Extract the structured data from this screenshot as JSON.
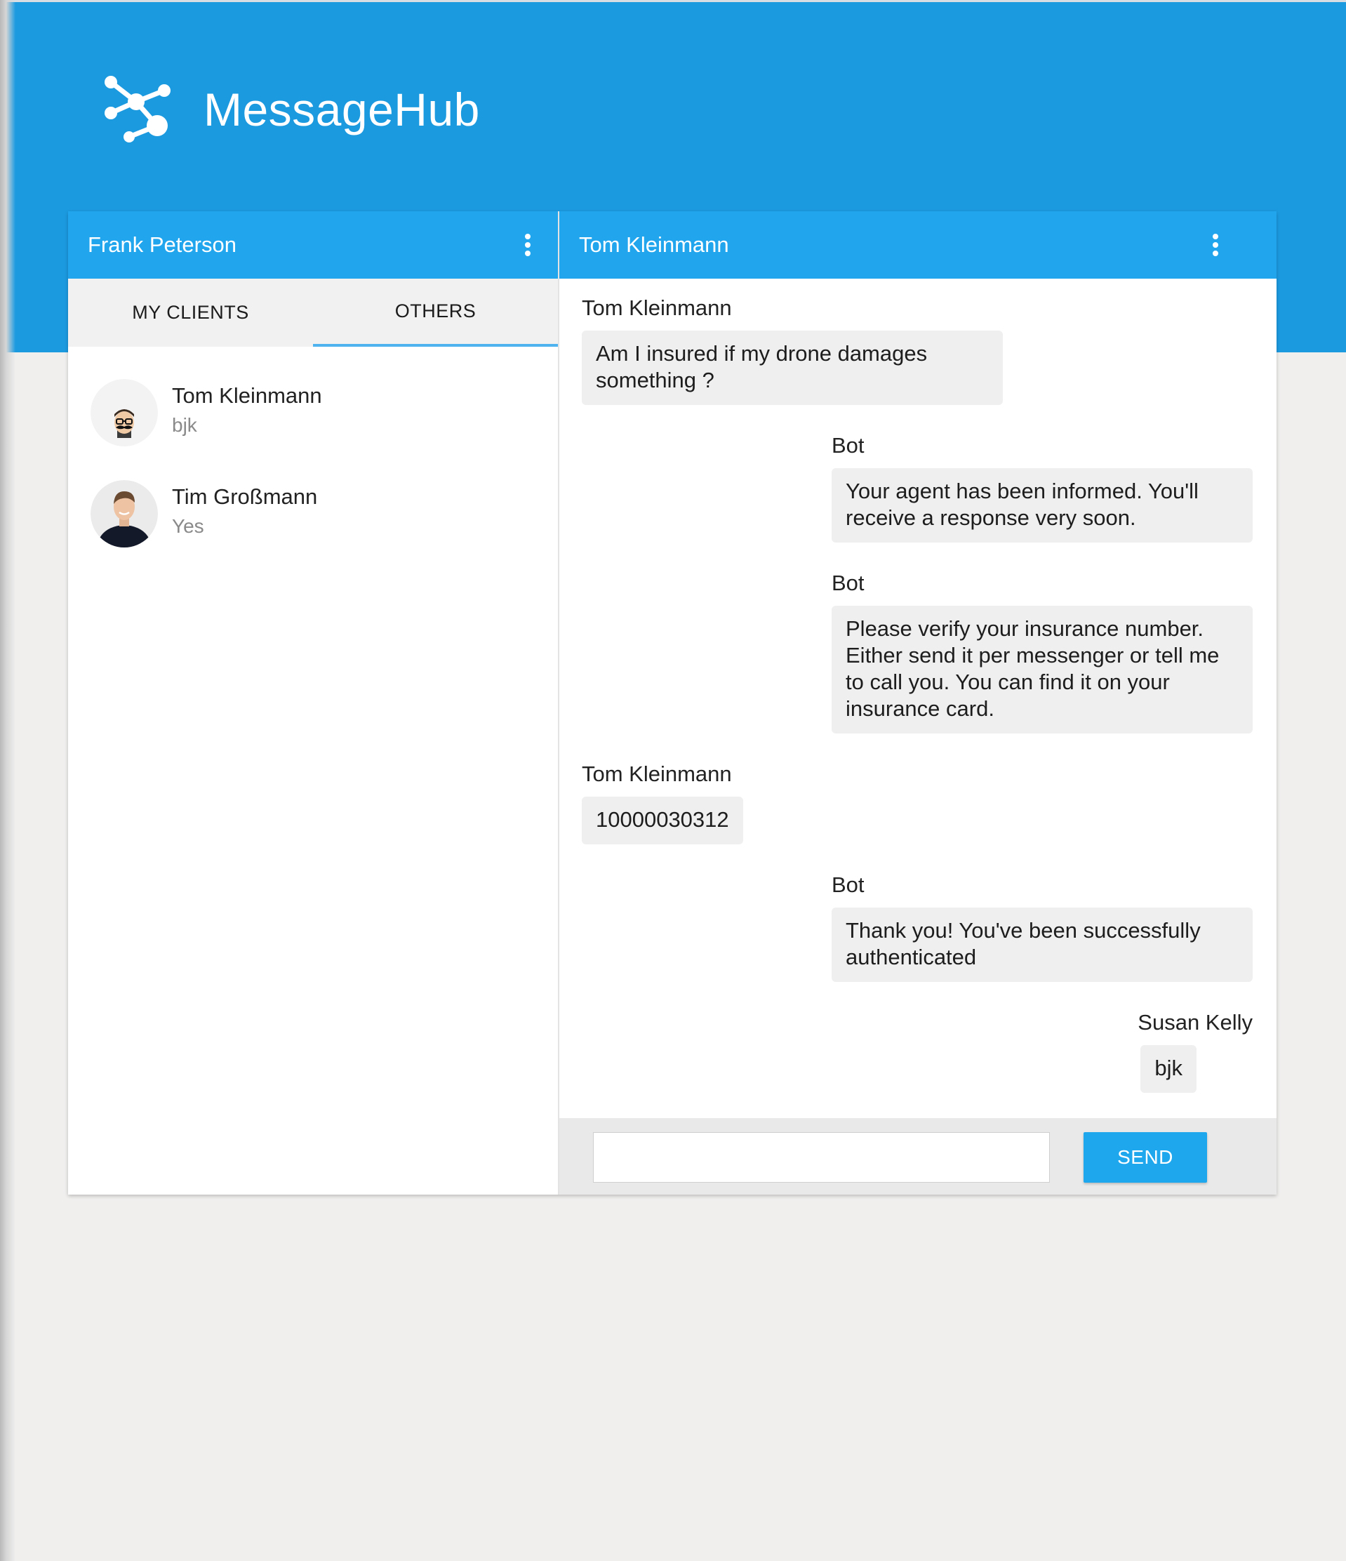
{
  "app": {
    "title": "MessageHub",
    "logo_icon": "network-share-icon",
    "accent_color": "#1c9ae0",
    "header_color": "#21a6ee"
  },
  "left_panel": {
    "header_name": "Frank Peterson",
    "menu_icon": "more-vert-icon",
    "tabs": [
      {
        "label": "MY CLIENTS",
        "active": false
      },
      {
        "label": "OTHERS",
        "active": true
      }
    ],
    "clients": [
      {
        "name": "Tom Kleinmann",
        "last_message": "bjk",
        "avatar": "avatar-mustache-icon"
      },
      {
        "name": "Tim Großmann",
        "last_message": "Yes",
        "avatar": "avatar-photo-icon"
      }
    ]
  },
  "chat": {
    "header_name": "Tom Kleinmann",
    "menu_icon": "more-vert-icon",
    "messages": [
      {
        "sender": "Tom Kleinmann",
        "side": "left",
        "lines": [
          "Am I insured if my drone damages",
          "something ?"
        ]
      },
      {
        "sender": "Bot",
        "side": "right",
        "lines": [
          "Your agent has been informed. You'll",
          "receive a response very soon."
        ]
      },
      {
        "sender": "Bot",
        "side": "right",
        "lines": [
          "Please verify your insurance number.",
          "Either send it per messenger or tell me",
          "to call you. You can find it on your",
          "insurance card."
        ]
      },
      {
        "sender": "Tom Kleinmann",
        "side": "left",
        "lines": [
          "10000030312"
        ]
      },
      {
        "sender": "Bot",
        "side": "right",
        "lines": [
          "Thank you! You've been successfully",
          "authenticated"
        ]
      },
      {
        "sender": "Susan Kelly",
        "side": "right",
        "lines": [
          "bjk"
        ]
      }
    ]
  },
  "composer": {
    "input_value": "",
    "input_placeholder": "",
    "send_label": "SEND"
  }
}
